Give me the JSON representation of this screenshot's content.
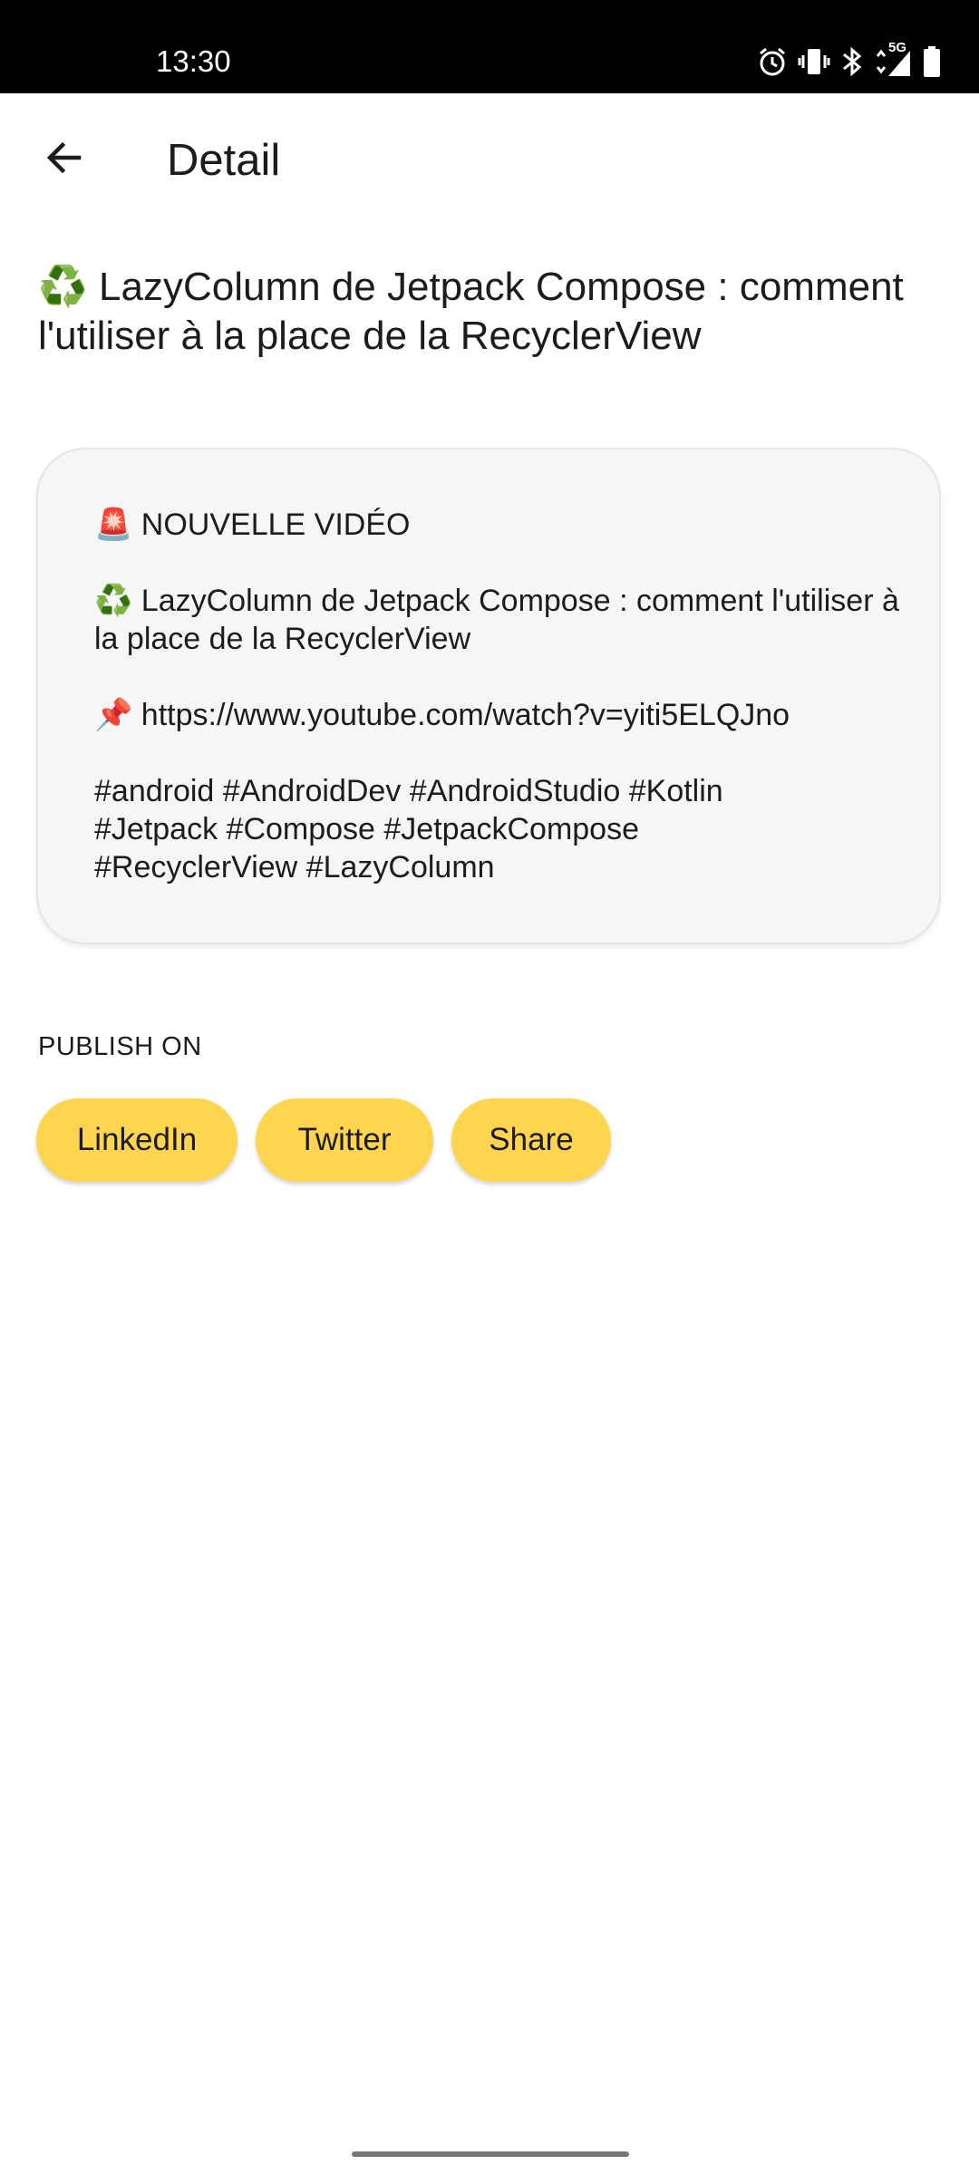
{
  "status_bar": {
    "time": "13:30",
    "icons": [
      "alarm-icon",
      "vibrate-icon",
      "bluetooth-icon",
      "network-5g-icon",
      "signal-icon",
      "battery-icon"
    ],
    "network_label": "5G"
  },
  "app_bar": {
    "back_icon": "arrow-back-icon",
    "title": "Detail"
  },
  "headline": {
    "emoji": "♻️",
    "text": "LazyColumn de Jetpack Compose : comment l'utiliser à la place de la RecyclerView"
  },
  "card": {
    "line1_emoji": "🚨",
    "line1_text": "NOUVELLE VIDÉO",
    "line2_emoji": "♻️",
    "line2_text": "LazyColumn de Jetpack Compose : comment l'utiliser à la place de la RecyclerView",
    "line3_emoji": "📌",
    "line3_text": "https://www.youtube.com/watch?v=yiti5ELQJno",
    "hashtags_line1": "#android #AndroidDev #AndroidStudio #Kotlin",
    "hashtags_line2": "#Jetpack #Compose #JetpackCompose",
    "hashtags_line3": "#RecyclerView #LazyColumn"
  },
  "publish": {
    "label": "PUBLISH ON",
    "buttons": [
      {
        "label": "LinkedIn"
      },
      {
        "label": "Twitter"
      },
      {
        "label": "Share"
      }
    ]
  },
  "colors": {
    "chip_background": "#ffd54f",
    "card_background": "#f6f6f6",
    "status_bar": "#000000"
  }
}
